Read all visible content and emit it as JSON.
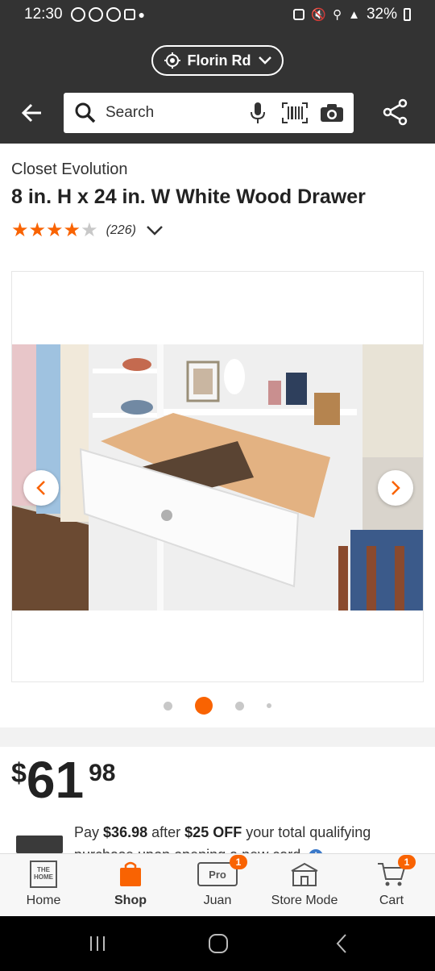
{
  "status_bar": {
    "time": "12:30",
    "battery": "32%"
  },
  "header": {
    "store_name": "Florin Rd",
    "search_placeholder": "Search",
    "icons": [
      "location-target-icon",
      "chevron-down-icon",
      "back-arrow-icon",
      "search-icon",
      "microphone-icon",
      "barcode-icon",
      "camera-icon",
      "share-icon"
    ]
  },
  "product": {
    "brand": "Closet Evolution",
    "title": "8 in. H x 24 in. W White Wood Drawer",
    "rating": 4,
    "rating_max": 5,
    "review_count": "(226)"
  },
  "gallery": {
    "total_dots": 4,
    "active_index": 1
  },
  "pricing": {
    "currency": "$",
    "dollars": "61",
    "cents": "98",
    "promo_pay": "Pay",
    "promo_amount": "$36.98",
    "promo_after": "after",
    "promo_off": "$25 OFF",
    "promo_text": "your total qualifying purchase upon opening a new card."
  },
  "tabs": [
    {
      "label": "Home",
      "icon": "home-depot-logo-icon",
      "active": false,
      "badge": ""
    },
    {
      "label": "Shop",
      "icon": "shop-bag-icon",
      "active": true,
      "badge": ""
    },
    {
      "label": "Juan",
      "icon": "prox-icon",
      "active": false,
      "badge": "1"
    },
    {
      "label": "Store Mode",
      "icon": "store-icon",
      "active": false,
      "badge": ""
    },
    {
      "label": "Cart",
      "icon": "cart-icon",
      "active": false,
      "badge": "1"
    }
  ],
  "colors": {
    "brand_orange": "#f96302",
    "header_bg": "#333333",
    "star_empty": "#c8c8c8"
  }
}
